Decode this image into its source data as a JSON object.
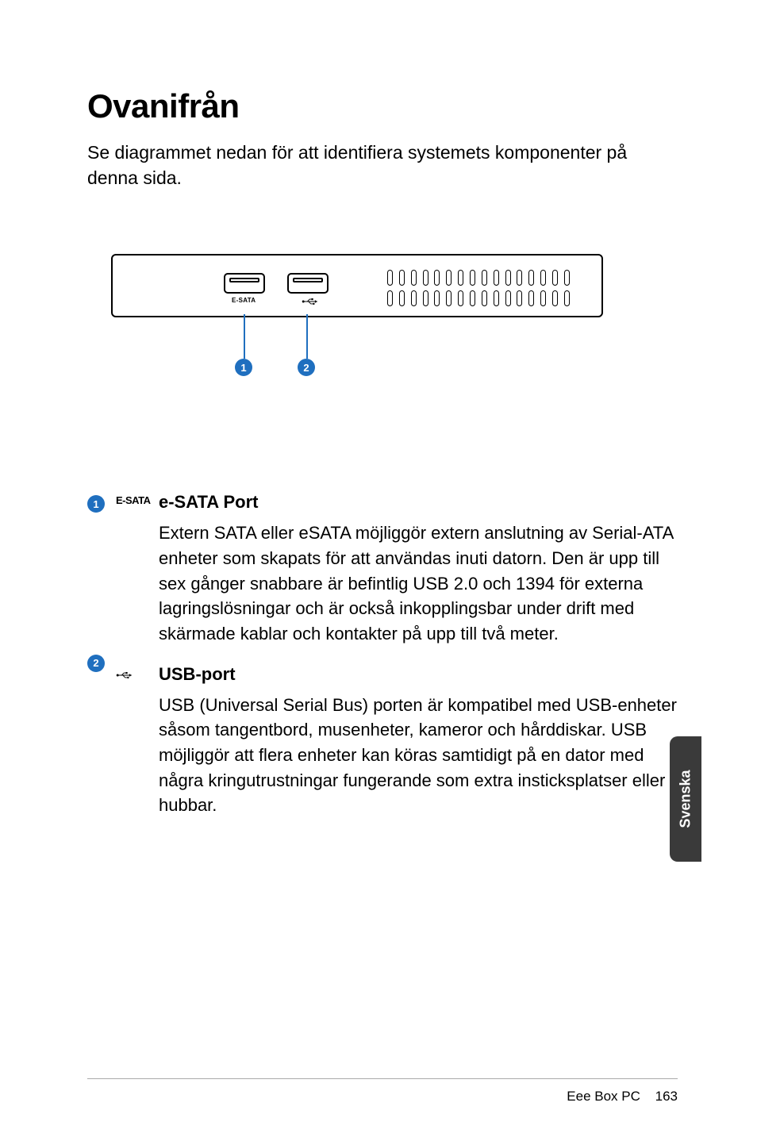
{
  "title": "Ovanifrån",
  "intro": "Se diagrammet nedan för att identifiera systemets komponenter på denna sida.",
  "diagram": {
    "port1_label": "E-SATA",
    "callout1": "1",
    "callout2": "2"
  },
  "defs": [
    {
      "num": "1",
      "icon_text": "E-SATA",
      "title": "e-SATA Port",
      "body": "Extern SATA eller eSATA möjliggör extern anslutning av Serial-ATA enheter som skapats för att användas inuti datorn. Den är upp till sex gånger snabbare är befintlig USB 2.0 och 1394 för externa lagringslösningar och är också inkopplingsbar under drift med skärmade kablar och kontakter på upp till två meter."
    },
    {
      "num": "2",
      "icon_text": "",
      "title": "USB-port",
      "body": "USB (Universal Serial Bus) porten är kompatibel med USB-enheter såsom tangentbord, musenheter, kameror och hårddiskar. USB möjliggör att flera enheter kan köras samtidigt på en dator med några kringutrustningar fungerande som extra insticksplatser eller hubbar."
    }
  ],
  "side_tab": "Svenska",
  "footer_product": "Eee Box PC",
  "footer_page": "163"
}
